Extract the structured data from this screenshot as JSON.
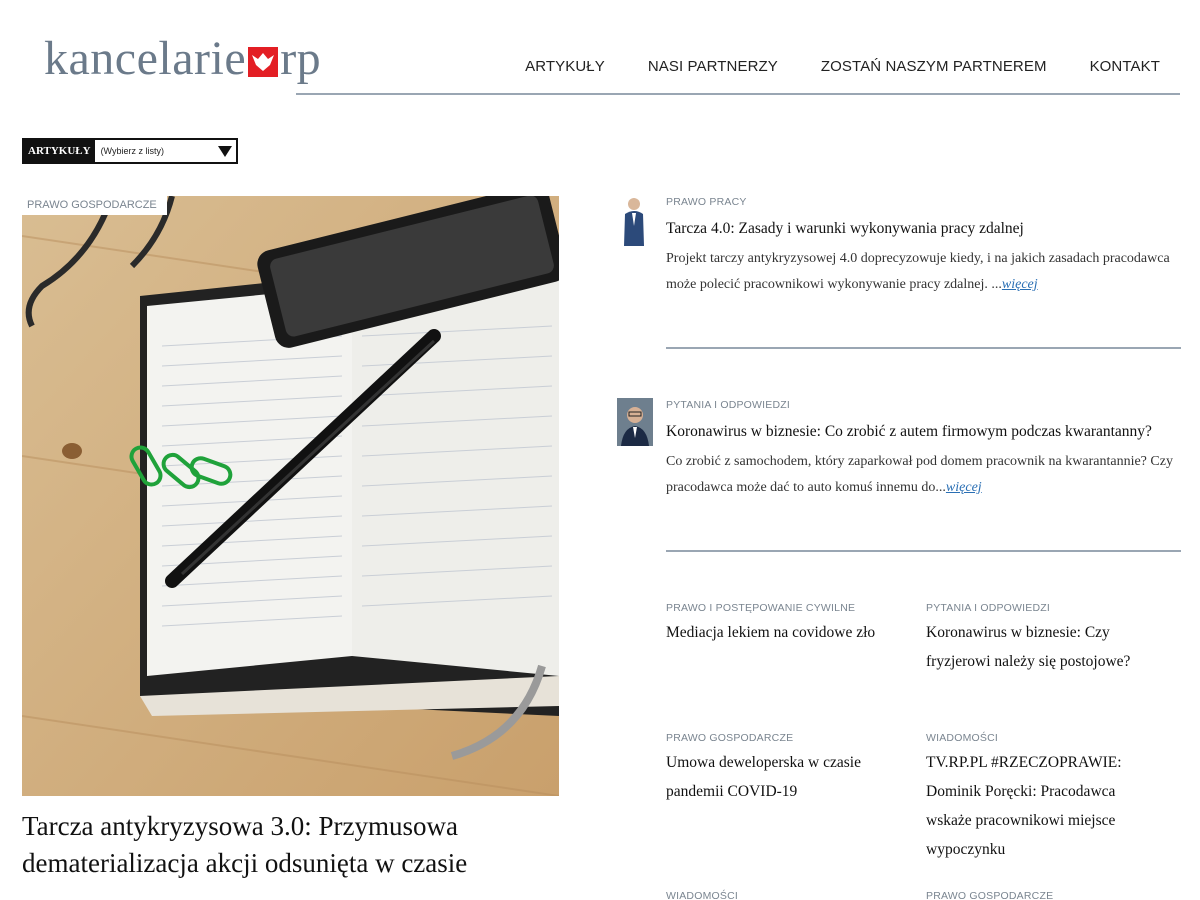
{
  "header": {
    "logo_left": "kancelarie",
    "logo_right": "rp",
    "nav": [
      "ARTYKUŁY",
      "NASI PARTNERZY",
      "ZOSTAŃ NASZYM PARTNEREM",
      "KONTAKT"
    ]
  },
  "selector": {
    "label": "ARTYKUŁY",
    "value": "(Wybierz z listy)"
  },
  "featured": {
    "category": "PRAWO GOSPODARCZE",
    "title": "Tarcza antykryzysowa 3.0: Przymusowa dematerializacja akcji odsunięta w czasie"
  },
  "articles": [
    {
      "category": "PRAWO PRACY",
      "title": "Tarcza 4.0: Zasady i warunki wykonywania pracy zdalnej",
      "excerpt": "Projekt tarczy antykryzysowej 4.0 doprecyzowuje kiedy, i na jakich zasadach pracodawca może polecić pracownikowi wykonywanie pracy zdalnej. ...",
      "more": "więcej"
    },
    {
      "category": "PYTANIA I ODPOWIEDZI",
      "title": "Koronawirus w biznesie: Co zrobić z autem firmowym podczas kwarantanny?",
      "excerpt": "Co zrobić z samochodem, który zaparkował pod domem pracownik na kwarantannie? Czy pracodawca może dać to auto komuś innemu do...",
      "more": "więcej"
    }
  ],
  "grid": [
    {
      "category": "PRAWO I POSTĘPOWANIE CYWILNE",
      "title": "Mediacja lekiem na covidowe zło"
    },
    {
      "category": "PYTANIA I ODPOWIEDZI",
      "title": "Koronawirus w biznesie: Czy fryzjerowi należy się postojowe?"
    },
    {
      "category": "PRAWO GOSPODARCZE",
      "title": "Umowa deweloperska w czasie pandemii COVID-19"
    },
    {
      "category": "WIADOMOŚCI",
      "title": "TV.RP.PL #RZECZOPRAWIE: Dominik Poręcki: Pracodawca wskaże pracownikowi miejsce wypoczynku"
    },
    {
      "category": "WIADOMOŚCI",
      "title": ""
    },
    {
      "category": "PRAWO GOSPODARCZE",
      "title": ""
    }
  ],
  "colors": {
    "accent_red": "#e31e24",
    "link_blue": "#2a6fb4",
    "divider": "#9aa6b3"
  }
}
